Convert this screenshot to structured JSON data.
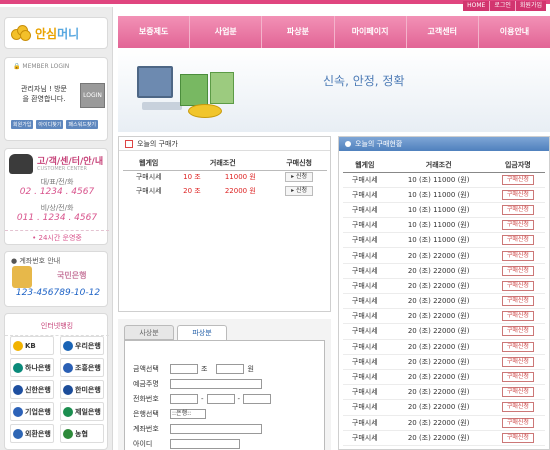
{
  "util": [
    "HOME",
    "로그인",
    "회원가입"
  ],
  "logo": {
    "text1": "안심",
    "text2": "머니"
  },
  "login": {
    "header": "MEMBER LOGIN",
    "msg_line1": "관리자님 ! 방문",
    "msg_line2": "을 환영합니다.",
    "button": "LOGIN",
    "links": [
      "회원가입",
      "아이디찾기",
      "패스워드찾기"
    ]
  },
  "customer_center": {
    "title": "고/객/센/터/안/내",
    "subtitle": "CUSTOMER CENTER",
    "rep_label": "대/표/전/화",
    "rep_number": "02 . 1234 . 4567",
    "fax_label": "비/상/전/화",
    "fax_number": "011 . 1234 . 4567",
    "hours": "24시간 운영중"
  },
  "account": {
    "header": "계좌번호 안내",
    "bank": "국민은행",
    "number": "123-456789-10-12"
  },
  "banking": {
    "header": "인터넷뱅킹",
    "banks": [
      "KB",
      "우리은행",
      "하나은행",
      "조흥은행",
      "신한은행",
      "한미은행",
      "기업은행",
      "제일은행",
      "외환은행",
      "농협"
    ],
    "bank_colors": [
      "#f2b300",
      "#1a64b5",
      "#0a8a7a",
      "#2a5fb4",
      "#1e4fa0",
      "#1c4d9a",
      "#2c62b8",
      "#1b8e4f",
      "#2e66b4",
      "#2d8a3a"
    ]
  },
  "nav": [
    "보증제도",
    "사업분",
    "파상분",
    "마이페이지",
    "고객센터",
    "이용안내"
  ],
  "hero": {
    "slogan": "신속, 안정, 정확"
  },
  "today": {
    "title": "오늘의 구매가",
    "headers": [
      "웹게임",
      "거래조건",
      "구매신청"
    ],
    "rows": [
      {
        "game": "구매시세",
        "qty": "10 조",
        "price": "11000 원",
        "btn": "▸ 신청"
      },
      {
        "game": "구매시세",
        "qty": "20 조",
        "price": "22000 원",
        "btn": "▸ 신청"
      }
    ]
  },
  "buy": {
    "tabs": [
      "사상분",
      "파상분"
    ],
    "fields": [
      {
        "label": "금액선택",
        "unit1": "조",
        "unit2": "원"
      },
      {
        "label": "예금주명"
      },
      {
        "label": "전화번호"
      },
      {
        "label": "은행선택",
        "select": "::은행::"
      },
      {
        "label": "계좌번호"
      },
      {
        "label": "아이디"
      }
    ]
  },
  "status": {
    "title": "오늘의 구매현황",
    "headers": [
      "웹게임",
      "거래조건",
      "입금자명"
    ],
    "rows": [
      [
        "구매시세",
        "10 (조) 11000 (원)",
        "구매신청"
      ],
      [
        "구매시세",
        "10 (조) 11000 (원)",
        "구매신청"
      ],
      [
        "구매시세",
        "10 (조) 11000 (원)",
        "구매신청"
      ],
      [
        "구매시세",
        "10 (조) 11000 (원)",
        "구매신청"
      ],
      [
        "구매시세",
        "10 (조) 11000 (원)",
        "구매신청"
      ],
      [
        "구매시세",
        "20 (조) 22000 (원)",
        "구매신청"
      ],
      [
        "구매시세",
        "20 (조) 22000 (원)",
        "구매신청"
      ],
      [
        "구매시세",
        "20 (조) 22000 (원)",
        "구매신청"
      ],
      [
        "구매시세",
        "20 (조) 22000 (원)",
        "구매신청"
      ],
      [
        "구매시세",
        "20 (조) 22000 (원)",
        "구매신청"
      ],
      [
        "구매시세",
        "20 (조) 22000 (원)",
        "구매신청"
      ],
      [
        "구매시세",
        "20 (조) 22000 (원)",
        "구매신청"
      ],
      [
        "구매시세",
        "20 (조) 22000 (원)",
        "구매신청"
      ],
      [
        "구매시세",
        "20 (조) 22000 (원)",
        "구매신청"
      ],
      [
        "구매시세",
        "20 (조) 22000 (원)",
        "구매신청"
      ],
      [
        "구매시세",
        "20 (조) 22000 (원)",
        "구매신청"
      ],
      [
        "구매시세",
        "20 (조) 22000 (원)",
        "구매신청"
      ],
      [
        "구매시세",
        "20 (조) 22000 (원)",
        "구매신청"
      ]
    ]
  }
}
